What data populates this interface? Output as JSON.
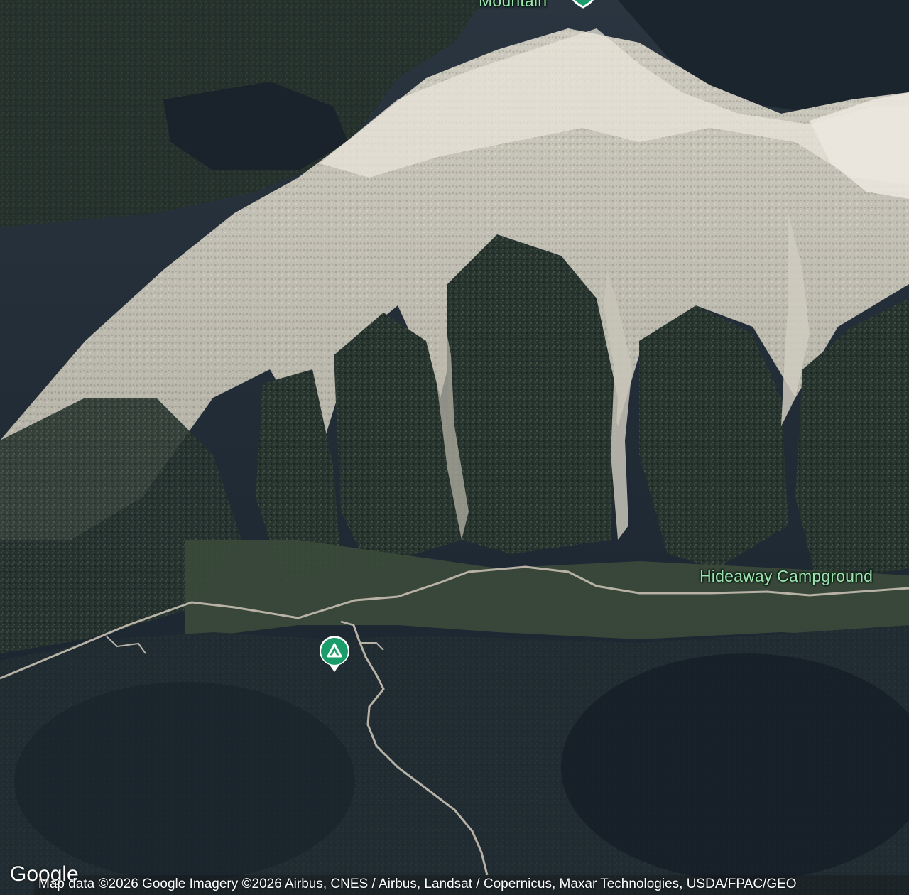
{
  "map": {
    "type": "satellite",
    "labels": {
      "mountain": "Mountain",
      "hideaway_campground": "Hideaway Campground"
    },
    "pins": {
      "campground_icon": "campground-icon",
      "pin_color": "#1a9c6b"
    },
    "logo": "Google",
    "attribution": "Map data ©2026 Google Imagery ©2026 Airbus, CNES / Airbus, Landsat / Copernicus, Maxar Technologies, USDA/FPAC/GEO"
  },
  "colors": {
    "label_green": "#9fe3b0",
    "pin_green": "#1a9c6b",
    "road": "#b8b2a6",
    "forest_dark": "#1c2630",
    "snow": "#d8d4c8"
  }
}
